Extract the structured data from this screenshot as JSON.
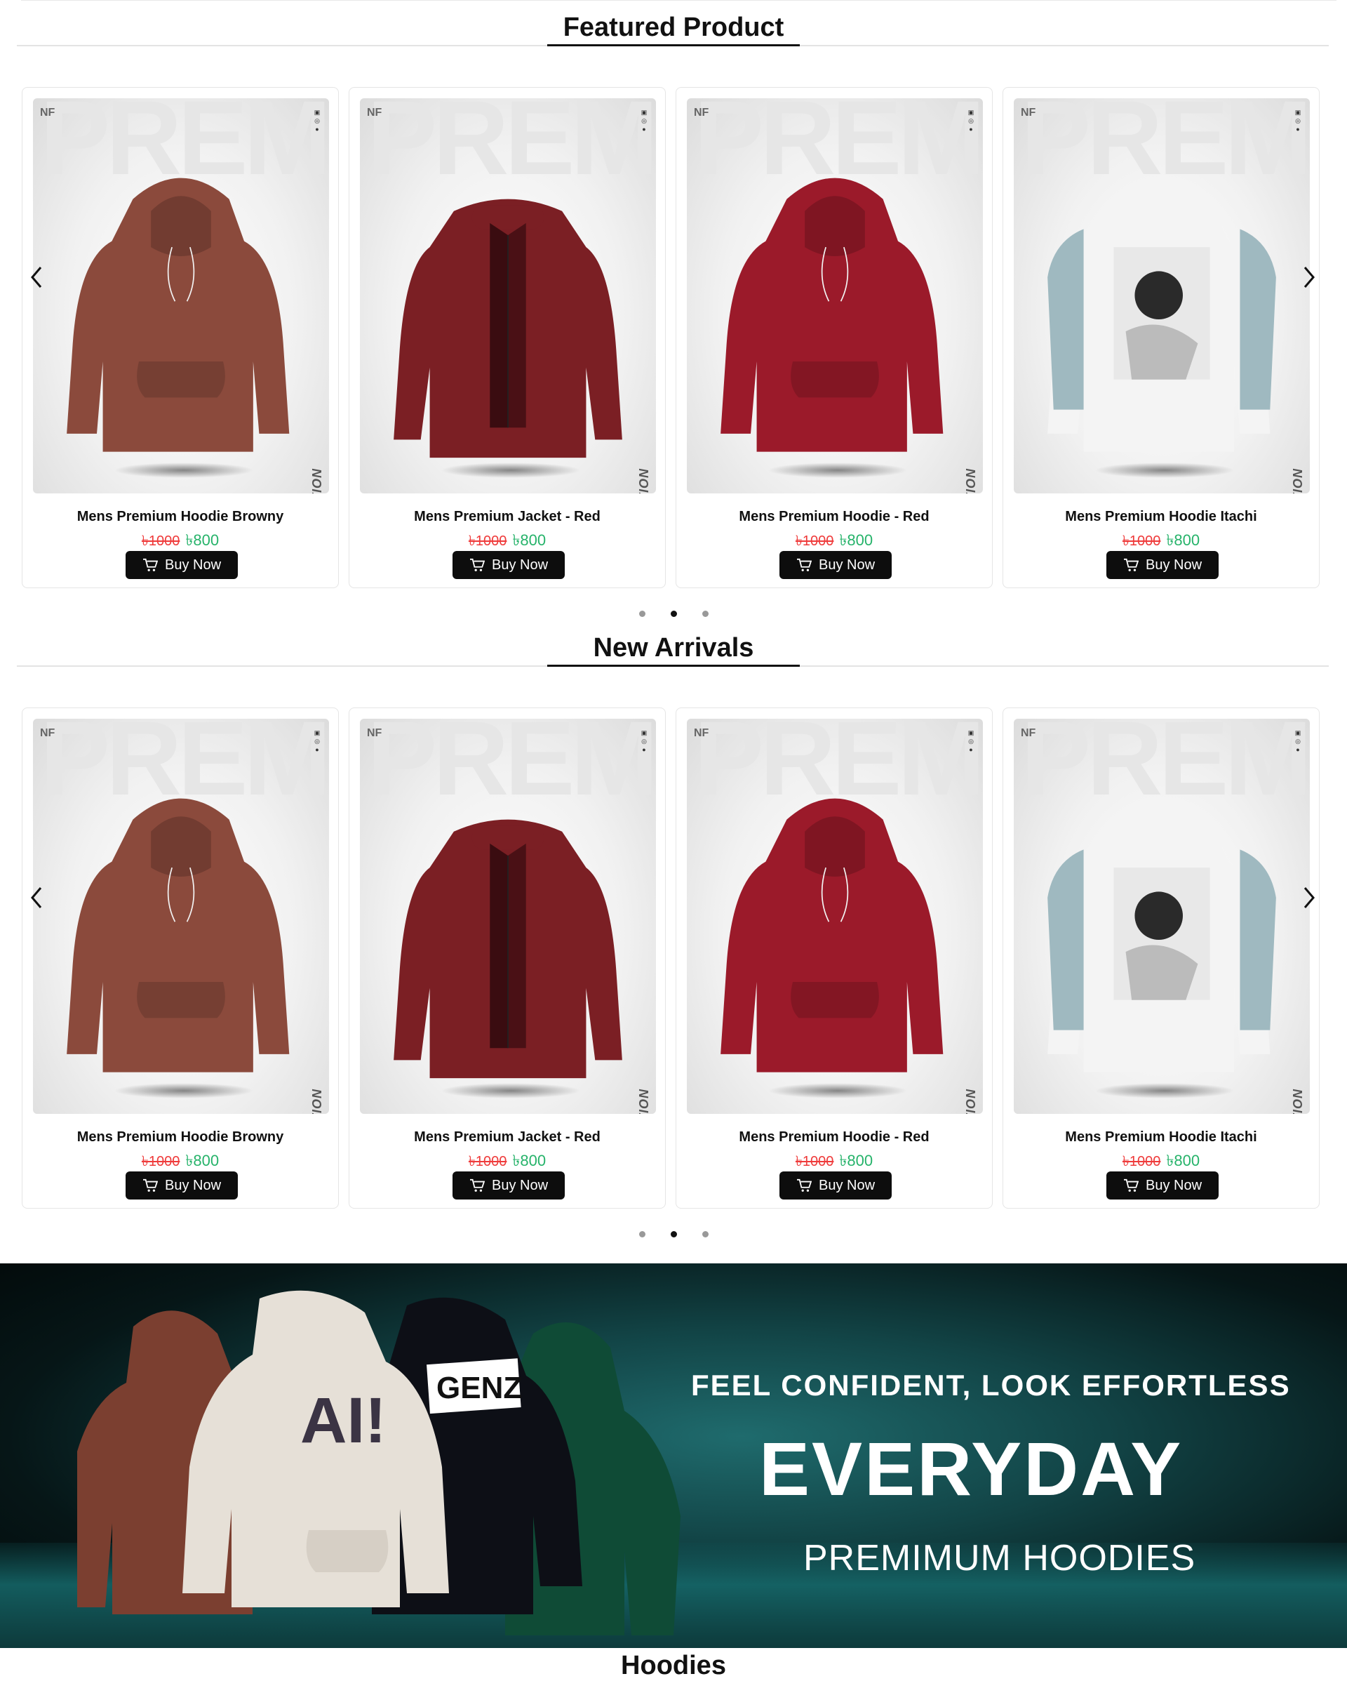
{
  "featured": {
    "title": "Featured Product",
    "products": [
      {
        "name": "Mens Premium Hoodie Browny",
        "old_price": "৳1000",
        "price": "৳800",
        "color": "#8b4a3c",
        "type": "hoodie"
      },
      {
        "name": "Mens Premium Jacket - Red",
        "old_price": "৳1000",
        "price": "৳800",
        "color": "#7b1f24",
        "type": "jacket"
      },
      {
        "name": "Mens Premium Hoodie - Red",
        "old_price": "৳1000",
        "price": "৳800",
        "color": "#9b1a2a",
        "type": "hoodie"
      },
      {
        "name": "Mens Premium Hoodie Itachi",
        "old_price": "৳1000",
        "price": "৳800",
        "color": "#f4f4f4",
        "type": "printed"
      }
    ]
  },
  "new_arrivals": {
    "title": "New Arrivals",
    "products": [
      {
        "name": "Mens Premium Hoodie Browny",
        "old_price": "৳1000",
        "price": "৳800",
        "color": "#8b4a3c",
        "type": "hoodie"
      },
      {
        "name": "Mens Premium Jacket - Red",
        "old_price": "৳1000",
        "price": "৳800",
        "color": "#7b1f24",
        "type": "jacket"
      },
      {
        "name": "Mens Premium Hoodie - Red",
        "old_price": "৳1000",
        "price": "৳800",
        "color": "#9b1a2a",
        "type": "hoodie"
      },
      {
        "name": "Mens Premium Hoodie Itachi",
        "old_price": "৳1000",
        "price": "৳800",
        "color": "#f4f4f4",
        "type": "printed"
      }
    ]
  },
  "card": {
    "buy_label": "Buy Now",
    "bg_word": "PREMIU",
    "edition_text": "PREMIUM EDITION",
    "logo_text": "NF"
  },
  "carousel": {
    "dot_count": 3,
    "active_dot": 1
  },
  "banner": {
    "tagline": "FEEL CONFIDENT, LOOK EFFORTLESS",
    "headline": "EVERYDAY",
    "subline": "PREMIMUM HOODIES",
    "hoodie_prints": [
      "AI!",
      "GENZ"
    ]
  },
  "next_section": {
    "title": "Hoodies"
  },
  "colors": {
    "old_price": "#ef3b3b",
    "new_price": "#26b36a",
    "button_bg": "#0d0d0d",
    "banner_teal": "#124446"
  }
}
